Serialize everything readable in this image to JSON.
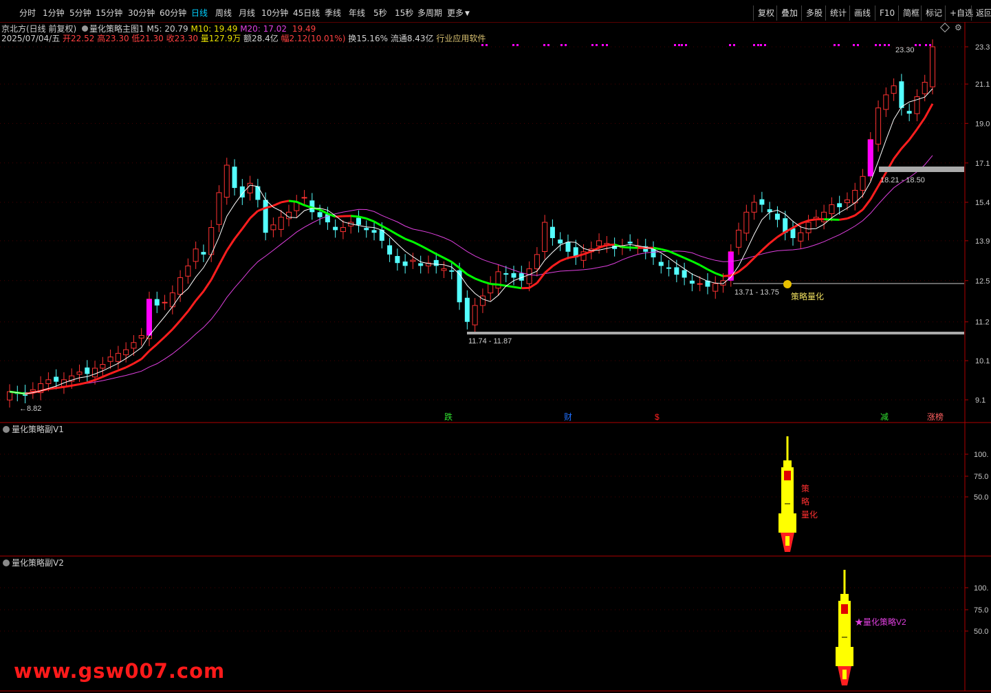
{
  "toolbar": {
    "periods": [
      "分时",
      "1分钟",
      "5分钟",
      "15分钟",
      "30分钟",
      "60分钟",
      "日线",
      "周线",
      "月线",
      "10分钟",
      "45日线",
      "季线",
      "年线",
      "5秒",
      "15秒",
      "多周期",
      "更多"
    ],
    "active_period": "日线",
    "right_buttons": [
      "复权",
      "叠加",
      "多股",
      "统计",
      "画线",
      "F10",
      "简框",
      "标记",
      "+自选",
      "返回"
    ]
  },
  "header": {
    "stock_name": "京北方(日线 前复权)",
    "indicator_name": "量化策略主图1",
    "ma5": "M5: 20.79",
    "ma10": "M10: 19.49",
    "ma20": "M20: 17.02",
    "extra": "19.49",
    "date": "2025/07/04/五",
    "open": "开22.52",
    "high": "高23.30",
    "low": "低21.30",
    "close": "收23.30",
    "volume": "量127.9万",
    "amount": "额28.4亿",
    "range": "幅2.12(10.01%)",
    "turnover": "换15.16%",
    "float_cap": "流通8.43亿",
    "industry": "行业应用软件"
  },
  "price_axis": [
    "23.3",
    "21.1",
    "19.0",
    "17.1",
    "15.4",
    "13.9",
    "12.5",
    "11.2",
    "10.1",
    "9.1"
  ],
  "annotations": {
    "low_label": "8.82",
    "high_label": "23.30",
    "range_1": "11.74 - 11.87",
    "range_2": "13.71 - 13.75",
    "range_3": "18.21 - 18.50",
    "strategy_label": "策略量化",
    "events": [
      "跌",
      "财",
      "$",
      "减",
      "涨榜"
    ]
  },
  "panel_v1": {
    "title": "量化策略副V1",
    "axis": [
      "100.",
      "75.0",
      "50.0"
    ],
    "side_text": [
      "策",
      "略",
      "量化"
    ]
  },
  "panel_v2": {
    "title": "量化策略副V2",
    "axis": [
      "100.",
      "75.0",
      "50.0"
    ],
    "legend": "★量化策略V2"
  },
  "watermark": "www.gsw007.com",
  "colors": {
    "up": "#ff3232",
    "down": "#54ffff",
    "ma5": "#ffffff",
    "ma10_up": "#ff1e1e",
    "ma10_down": "#00ff00",
    "ma20": "#e040e0",
    "signal": "#ff00ff",
    "rocket": "#ffff00"
  },
  "chart_data": {
    "type": "candlestick",
    "price_ticks": [
      23.3,
      21.1,
      19.0,
      17.1,
      15.4,
      13.9,
      12.5,
      11.2,
      10.1,
      9.1
    ],
    "last_close": 23.3,
    "period_low": 8.82,
    "period_high": 23.3,
    "ma5_last": 20.79,
    "ma10_last": 19.49,
    "ma20_last": 17.02
  }
}
